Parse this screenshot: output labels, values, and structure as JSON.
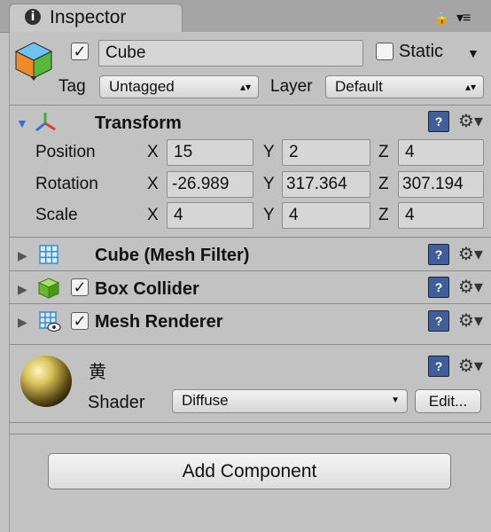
{
  "tab": {
    "title": "Inspector"
  },
  "object": {
    "name": "Cube",
    "active": true,
    "static_label": "Static",
    "static_checked": false
  },
  "tag": {
    "label": "Tag",
    "value": "Untagged"
  },
  "layer": {
    "label": "Layer",
    "value": "Default"
  },
  "transform": {
    "title": "Transform",
    "position": {
      "label": "Position",
      "x": "15",
      "y": "2",
      "z": "4"
    },
    "rotation": {
      "label": "Rotation",
      "x": "-26.989",
      "y": "317.364",
      "z": "307.194"
    },
    "scale": {
      "label": "Scale",
      "x": "4",
      "y": "4",
      "z": "4"
    },
    "axis_x": "X",
    "axis_y": "Y",
    "axis_z": "Z"
  },
  "components": [
    {
      "title": "Cube (Mesh Filter)",
      "has_checkbox": false
    },
    {
      "title": "Box Collider",
      "has_checkbox": true
    },
    {
      "title": "Mesh Renderer",
      "has_checkbox": true
    }
  ],
  "material": {
    "name": "黄",
    "shader_label": "Shader",
    "shader_value": "Diffuse",
    "edit_label": "Edit..."
  },
  "add_component_label": "Add Component",
  "icons": {
    "tab": "info-icon",
    "lock": "lock-icon",
    "menu": "context-menu-icon",
    "gameobject": "cube-icon",
    "transform": "transform-axes-icon",
    "mesh_filter": "mesh-grid-icon",
    "box_collider": "collider-cube-icon",
    "mesh_renderer": "mesh-renderer-icon",
    "help": "help-book-icon",
    "gear": "gear-icon",
    "material": "material-sphere-icon"
  },
  "colors": {
    "background": "#c2c2c2",
    "tabbar": "#a5a5a5",
    "field": "#d6d6d6",
    "fold_triangle": "#2f6fe0"
  }
}
